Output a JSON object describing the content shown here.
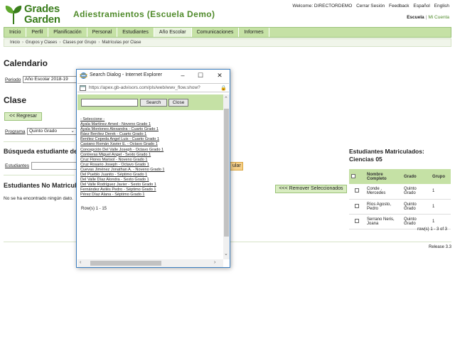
{
  "header": {
    "logo_line1": "Grades",
    "logo_line2": "Garden",
    "app_title": "Adiestramientos (Escuela Demo)",
    "welcome": "Welcome: DIRECTORDEMO",
    "logout": "Cerrar Sesión",
    "feedback": "Feedback",
    "lang_es": "Español",
    "lang_en": "English",
    "school_label": "Escuela",
    "school_sep": "|",
    "my_account": "Mi Cuenta"
  },
  "nav": {
    "items": [
      {
        "label": "Inicio"
      },
      {
        "label": "Perfil"
      },
      {
        "label": "Planificación"
      },
      {
        "label": "Personal"
      },
      {
        "label": "Estudiantes"
      },
      {
        "label": "Año Escolar"
      },
      {
        "label": "Comunicaciones"
      },
      {
        "label": "Informes"
      }
    ],
    "active_index": 5
  },
  "breadcrumbs": [
    "Inicio",
    "Grupos y Clases",
    "Clases por Grupo",
    "Matrículas por Clase"
  ],
  "calendar": {
    "heading": "Calendario",
    "period_label": "Periodo",
    "period_value": "Año Escolar 2018-19"
  },
  "class_section": {
    "heading": "Clase",
    "back_button": "<< Regresar",
    "program_label": "Programa",
    "program_value": "Quinto Grado"
  },
  "search_section": {
    "heading": "Búsqueda estudiante de",
    "students_label": "Estudiantes",
    "search_button_partial": "ular"
  },
  "unenrolled": {
    "heading": "Estudiantes No Matricula",
    "empty_message": "No se ha encontrado ningún dato."
  },
  "enrolled": {
    "title_line1": "Estudiantes Matriculados:",
    "title_line2": "Ciencias 05",
    "remove_button": "<<< Remover Seleccionados",
    "columns": [
      "Nombre\nCompleto",
      "Grado",
      "Grupo"
    ],
    "col_name_1": "Nombre",
    "col_name_2": "Completo",
    "rows": [
      {
        "name_1": "Conde ,",
        "name_2": "Mercedes",
        "grade_1": "Quinto",
        "grade_2": "Grado",
        "group": "1"
      },
      {
        "name_1": "Ríos Agosto,",
        "name_2": "Pedro",
        "grade_1": "Quinto",
        "grade_2": "Grado",
        "group": "1"
      },
      {
        "name_1": "Serrano Neris,",
        "name_2": "Joana",
        "grade_1": "Quinto",
        "grade_2": "Grado",
        "group": "1"
      }
    ],
    "row_count": "row(s) 1 - 3 of 3"
  },
  "footer": {
    "release": "Release 3.3"
  },
  "dialog": {
    "title": "Search Dialog - Internet Explorer",
    "url": "https://apex.gb-advisors.com/pls/web/wwv_flow.show?",
    "search_button": "Search",
    "close_button": "Close",
    "search_value": "",
    "items": [
      "- Seleccione -",
      "Ayala Martínez Amed - Noveno Grado 1",
      "Ayala Montones Alexandra - Cuarto Grado 1",
      "Báez Benítez Derek - Cuarto Grado 1",
      "Benítez Cepeda Angel Luis - Cuarto Grado 1",
      "Casiano Román Xavier E. - Octavo Grado 1",
      "Concepción Del Valle Joseph - Octavo Grado 1",
      "Contreras Miguel Angel - Sexto Grado 1",
      "Cruz Flores Marisol - Noveno Grado 1",
      "Cruz Rosario Joseph - Octavo Grado 1",
      "Cuevas Jiménez Jonathan A. - Noveno Grado 1",
      "Del Pueblo Juanito - Séptimo Grado 1",
      "Del Valle Díaz Alondra - Sexto Grado 1",
      "Del Valle Rodríguez Javier - Sexto Grado 1",
      "Fernández Avilés Pedro - Séptimo Grado 1",
      "Pérez Díaz Alana - Séptimo Grado 1"
    ],
    "rows_label": "Row(s) 1 - 15"
  },
  "colors": {
    "brand_green": "#4f8a2a",
    "nav_green": "#c5e1a5",
    "window_border": "#3c7fc0",
    "orange_button": "#f6d089"
  }
}
